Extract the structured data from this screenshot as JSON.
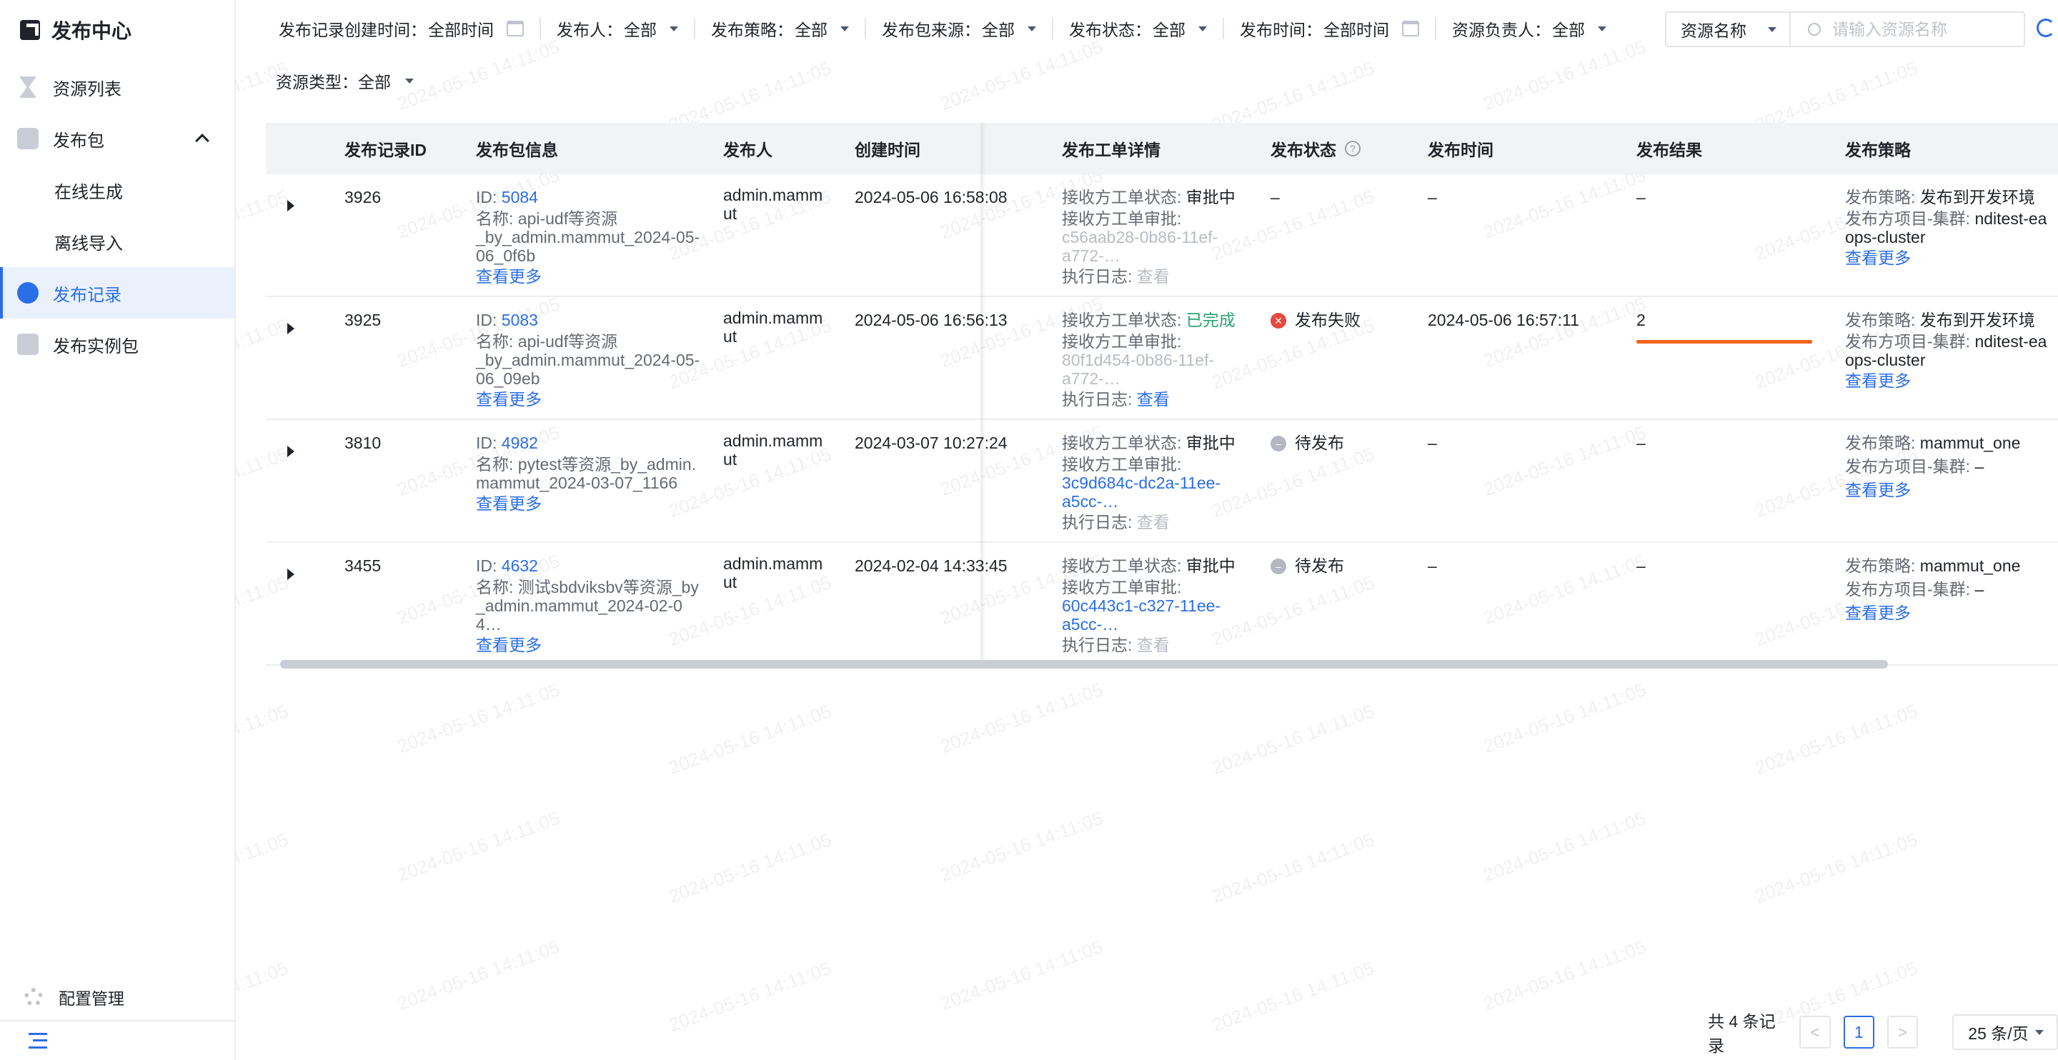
{
  "sidebar": {
    "brand": "发布中心",
    "items": [
      {
        "label": "资源列表"
      },
      {
        "label": "发布包"
      },
      {
        "label": "在线生成"
      },
      {
        "label": "离线导入"
      },
      {
        "label": "发布记录"
      },
      {
        "label": "发布实例包"
      }
    ],
    "config": "配置管理"
  },
  "filters": [
    {
      "key": "发布记录创建时间：",
      "value": "全部时间"
    },
    {
      "key": "发布人：",
      "value": "全部"
    },
    {
      "key": "发布策略：",
      "value": "全部"
    },
    {
      "key": "发布包来源：",
      "value": "全部"
    },
    {
      "key": "发布状态：",
      "value": "全部"
    },
    {
      "key": "发布时间：",
      "value": "全部时间"
    },
    {
      "key": "资源负责人：",
      "value": "全部"
    }
  ],
  "search": {
    "select": "资源名称",
    "placeholder": "请输入资源名称"
  },
  "resource_type": {
    "key": "资源类型：",
    "value": "全部"
  },
  "table": {
    "headers": [
      "发布记录ID",
      "发布包信息",
      "发布人",
      "创建时间",
      "发布工单详情",
      "发布状态",
      "发布时间",
      "发布结果",
      "发布策略"
    ],
    "rows": [
      {
        "id": "3926",
        "pkg_id_label": "ID: ",
        "pkg_id": "5084",
        "pkg_name": "名称: api-udf等资源_by_admin.mammut_2024-05-06_0f6b",
        "more": "查看更多",
        "publisher": "admin.mammut",
        "created": "2024-05-06 16:58:08",
        "order_status_label": "接收方工单状态: ",
        "order_status": "审批中",
        "order_approval_label": "接收方工单审批: ",
        "order_approval": "c56aab28-0b86-11ef-a772-…",
        "log_label": "执行日志: ",
        "log": "查看",
        "pub_status": "–",
        "pub_time": "–",
        "result": "–",
        "strategy_label": "发布策略: ",
        "strategy": "发布到开发环境",
        "cluster_label": "发布方项目-集群: ",
        "cluster": "nditest-eaops-cluster",
        "strategy_more": "查看更多"
      },
      {
        "id": "3925",
        "pkg_id_label": "ID: ",
        "pkg_id": "5083",
        "pkg_name": "名称: api-udf等资源_by_admin.mammut_2024-05-06_09eb",
        "more": "查看更多",
        "publisher": "admin.mammut",
        "created": "2024-05-06 16:56:13",
        "order_status_label": "接收方工单状态: ",
        "order_status": "已完成",
        "order_approval_label": "接收方工单审批: ",
        "order_approval": "80f1d454-0b86-11ef-a772-…",
        "log_label": "执行日志: ",
        "log": "查看",
        "pub_status": "发布失败",
        "pub_time": "2024-05-06 16:57:11",
        "result": "2",
        "strategy_label": "发布策略: ",
        "strategy": "发布到开发环境",
        "cluster_label": "发布方项目-集群: ",
        "cluster": "nditest-eaops-cluster",
        "strategy_more": "查看更多"
      },
      {
        "id": "3810",
        "pkg_id_label": "ID: ",
        "pkg_id": "4982",
        "pkg_name": "名称: pytest等资源_by_admin.mammut_2024-03-07_1166",
        "more": "查看更多",
        "publisher": "admin.mammut",
        "created": "2024-03-07 10:27:24",
        "order_status_label": "接收方工单状态: ",
        "order_status": "审批中",
        "order_approval_label": "接收方工单审批: ",
        "order_approval": "3c9d684c-dc2a-11ee-a5cc-…",
        "log_label": "执行日志: ",
        "log": "查看",
        "pub_status": "待发布",
        "pub_time": "–",
        "result": "–",
        "strategy_label": "发布策略: ",
        "strategy": "mammut_one",
        "cluster_label": "发布方项目-集群: ",
        "cluster": "–",
        "strategy_more": "查看更多"
      },
      {
        "id": "3455",
        "pkg_id_label": "ID: ",
        "pkg_id": "4632",
        "pkg_name": "名称: 测试sbdviksbv等资源_by_admin.mammut_2024-02-04…",
        "more": "查看更多",
        "publisher": "admin.mammut",
        "created": "2024-02-04 14:33:45",
        "order_status_label": "接收方工单状态: ",
        "order_status": "审批中",
        "order_approval_label": "接收方工单审批: ",
        "order_approval": "60c443c1-c327-11ee-a5cc-…",
        "log_label": "执行日志: ",
        "log": "查看",
        "pub_status": "待发布",
        "pub_time": "–",
        "result": "–",
        "strategy_label": "发布策略: ",
        "strategy": "mammut_one",
        "cluster_label": "发布方项目-集群: ",
        "cluster": "–",
        "strategy_more": "查看更多"
      }
    ]
  },
  "pagination": {
    "total": "共 4 条记录",
    "prev": "<",
    "page": "1",
    "next": ">",
    "size": "25 条/页"
  },
  "watermark": "2024-05-16 14:11:05",
  "colors": {
    "accent": "#2a6ee8",
    "success": "#2ba471",
    "fail": "#e8473f",
    "highlight": "#f0651c"
  }
}
